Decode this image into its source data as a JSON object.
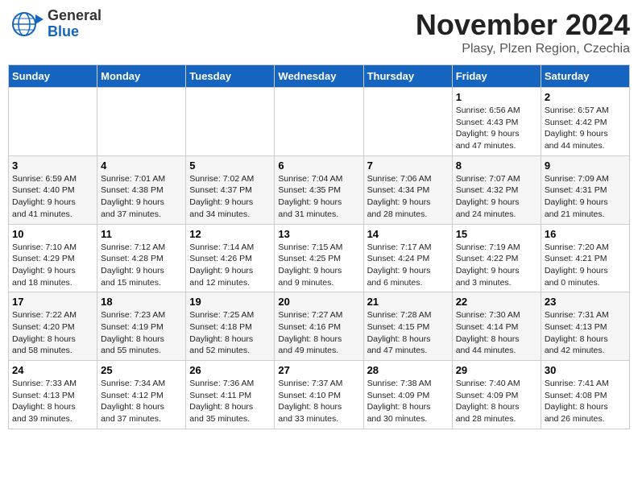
{
  "header": {
    "logo_general": "General",
    "logo_blue": "Blue",
    "month_title": "November 2024",
    "location": "Plasy, Plzen Region, Czechia"
  },
  "days_of_week": [
    "Sunday",
    "Monday",
    "Tuesday",
    "Wednesday",
    "Thursday",
    "Friday",
    "Saturday"
  ],
  "weeks": [
    {
      "cells": [
        {
          "day": "",
          "info": ""
        },
        {
          "day": "",
          "info": ""
        },
        {
          "day": "",
          "info": ""
        },
        {
          "day": "",
          "info": ""
        },
        {
          "day": "",
          "info": ""
        },
        {
          "day": "1",
          "info": "Sunrise: 6:56 AM\nSunset: 4:43 PM\nDaylight: 9 hours\nand 47 minutes."
        },
        {
          "day": "2",
          "info": "Sunrise: 6:57 AM\nSunset: 4:42 PM\nDaylight: 9 hours\nand 44 minutes."
        }
      ]
    },
    {
      "cells": [
        {
          "day": "3",
          "info": "Sunrise: 6:59 AM\nSunset: 4:40 PM\nDaylight: 9 hours\nand 41 minutes."
        },
        {
          "day": "4",
          "info": "Sunrise: 7:01 AM\nSunset: 4:38 PM\nDaylight: 9 hours\nand 37 minutes."
        },
        {
          "day": "5",
          "info": "Sunrise: 7:02 AM\nSunset: 4:37 PM\nDaylight: 9 hours\nand 34 minutes."
        },
        {
          "day": "6",
          "info": "Sunrise: 7:04 AM\nSunset: 4:35 PM\nDaylight: 9 hours\nand 31 minutes."
        },
        {
          "day": "7",
          "info": "Sunrise: 7:06 AM\nSunset: 4:34 PM\nDaylight: 9 hours\nand 28 minutes."
        },
        {
          "day": "8",
          "info": "Sunrise: 7:07 AM\nSunset: 4:32 PM\nDaylight: 9 hours\nand 24 minutes."
        },
        {
          "day": "9",
          "info": "Sunrise: 7:09 AM\nSunset: 4:31 PM\nDaylight: 9 hours\nand 21 minutes."
        }
      ]
    },
    {
      "cells": [
        {
          "day": "10",
          "info": "Sunrise: 7:10 AM\nSunset: 4:29 PM\nDaylight: 9 hours\nand 18 minutes."
        },
        {
          "day": "11",
          "info": "Sunrise: 7:12 AM\nSunset: 4:28 PM\nDaylight: 9 hours\nand 15 minutes."
        },
        {
          "day": "12",
          "info": "Sunrise: 7:14 AM\nSunset: 4:26 PM\nDaylight: 9 hours\nand 12 minutes."
        },
        {
          "day": "13",
          "info": "Sunrise: 7:15 AM\nSunset: 4:25 PM\nDaylight: 9 hours\nand 9 minutes."
        },
        {
          "day": "14",
          "info": "Sunrise: 7:17 AM\nSunset: 4:24 PM\nDaylight: 9 hours\nand 6 minutes."
        },
        {
          "day": "15",
          "info": "Sunrise: 7:19 AM\nSunset: 4:22 PM\nDaylight: 9 hours\nand 3 minutes."
        },
        {
          "day": "16",
          "info": "Sunrise: 7:20 AM\nSunset: 4:21 PM\nDaylight: 9 hours\nand 0 minutes."
        }
      ]
    },
    {
      "cells": [
        {
          "day": "17",
          "info": "Sunrise: 7:22 AM\nSunset: 4:20 PM\nDaylight: 8 hours\nand 58 minutes."
        },
        {
          "day": "18",
          "info": "Sunrise: 7:23 AM\nSunset: 4:19 PM\nDaylight: 8 hours\nand 55 minutes."
        },
        {
          "day": "19",
          "info": "Sunrise: 7:25 AM\nSunset: 4:18 PM\nDaylight: 8 hours\nand 52 minutes."
        },
        {
          "day": "20",
          "info": "Sunrise: 7:27 AM\nSunset: 4:16 PM\nDaylight: 8 hours\nand 49 minutes."
        },
        {
          "day": "21",
          "info": "Sunrise: 7:28 AM\nSunset: 4:15 PM\nDaylight: 8 hours\nand 47 minutes."
        },
        {
          "day": "22",
          "info": "Sunrise: 7:30 AM\nSunset: 4:14 PM\nDaylight: 8 hours\nand 44 minutes."
        },
        {
          "day": "23",
          "info": "Sunrise: 7:31 AM\nSunset: 4:13 PM\nDaylight: 8 hours\nand 42 minutes."
        }
      ]
    },
    {
      "cells": [
        {
          "day": "24",
          "info": "Sunrise: 7:33 AM\nSunset: 4:13 PM\nDaylight: 8 hours\nand 39 minutes."
        },
        {
          "day": "25",
          "info": "Sunrise: 7:34 AM\nSunset: 4:12 PM\nDaylight: 8 hours\nand 37 minutes."
        },
        {
          "day": "26",
          "info": "Sunrise: 7:36 AM\nSunset: 4:11 PM\nDaylight: 8 hours\nand 35 minutes."
        },
        {
          "day": "27",
          "info": "Sunrise: 7:37 AM\nSunset: 4:10 PM\nDaylight: 8 hours\nand 33 minutes."
        },
        {
          "day": "28",
          "info": "Sunrise: 7:38 AM\nSunset: 4:09 PM\nDaylight: 8 hours\nand 30 minutes."
        },
        {
          "day": "29",
          "info": "Sunrise: 7:40 AM\nSunset: 4:09 PM\nDaylight: 8 hours\nand 28 minutes."
        },
        {
          "day": "30",
          "info": "Sunrise: 7:41 AM\nSunset: 4:08 PM\nDaylight: 8 hours\nand 26 minutes."
        }
      ]
    }
  ]
}
